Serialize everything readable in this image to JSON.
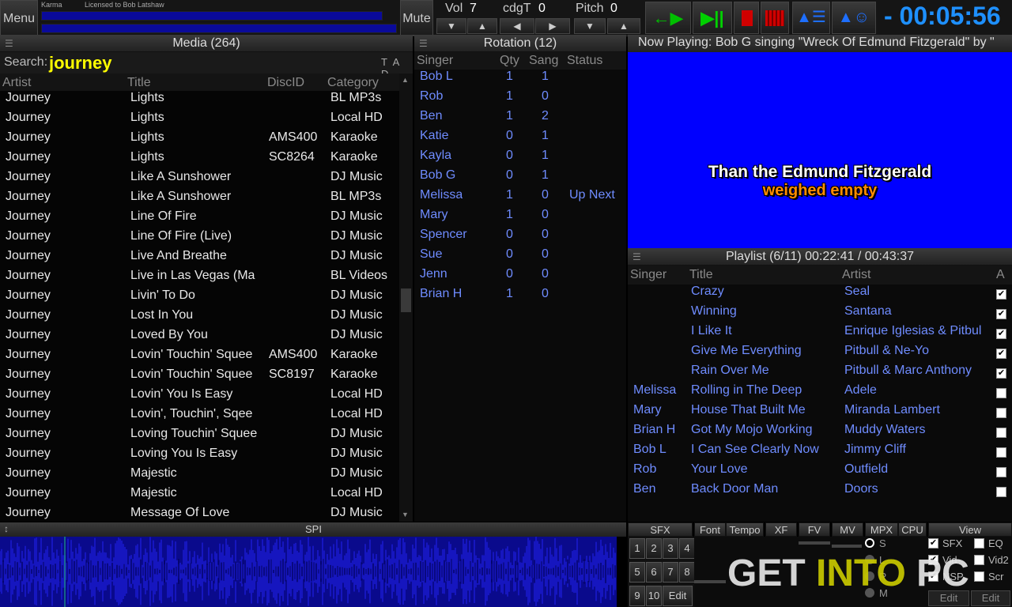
{
  "topbar": {
    "menu_label": "Menu",
    "karma_label": "Karma",
    "license_text": "Licensed to Bob Latshaw",
    "mute_label": "Mute",
    "vol_label": "Vol",
    "vol_value": "7",
    "cdgt_label": "cdgT",
    "cdgt_value": "0",
    "pitch_label": "Pitch",
    "pitch_value": "0",
    "timer": "- 00:05:56",
    "icons": {
      "arrow_down": "▼",
      "arrow_up": "▲",
      "arrow_left": "◀",
      "arrow_right": "▶",
      "prev": "←▶",
      "play_pause": "▶||",
      "stop": "stop-icon",
      "queue": "▲☰",
      "singer": "▲☺"
    },
    "colors": {
      "blue_text": "#1e90ff",
      "green": "#00c000",
      "red": "#d00000"
    }
  },
  "media": {
    "title": "Media (264)",
    "search_label": "Search:",
    "search_value": "journey",
    "tad": "T A D",
    "columns": [
      "Artist",
      "Title",
      "DiscID",
      "Category"
    ],
    "rows": [
      [
        "Journey",
        "Lights",
        "",
        "BL MP3s"
      ],
      [
        "Journey",
        "Lights",
        "",
        "Local HD"
      ],
      [
        "Journey",
        "Lights",
        "AMS400",
        "Karaoke"
      ],
      [
        "Journey",
        "Lights",
        "SC8264",
        "Karaoke"
      ],
      [
        "Journey",
        "Like A Sunshower",
        "",
        "DJ Music"
      ],
      [
        "Journey",
        "Like A Sunshower",
        "",
        "BL MP3s"
      ],
      [
        "Journey",
        "Line Of Fire",
        "",
        "DJ Music"
      ],
      [
        "Journey",
        "Line Of Fire (Live)",
        "",
        "DJ Music"
      ],
      [
        "Journey",
        "Live And Breathe",
        "",
        "DJ Music"
      ],
      [
        "Journey",
        "Live in Las Vegas (Ma",
        "",
        "BL Videos"
      ],
      [
        "Journey",
        "Livin' To Do",
        "",
        "DJ Music"
      ],
      [
        "Journey",
        "Lost In You",
        "",
        "DJ Music"
      ],
      [
        "Journey",
        "Loved By You",
        "",
        "DJ Music"
      ],
      [
        "Journey",
        "Lovin' Touchin' Squee",
        "AMS400",
        "Karaoke"
      ],
      [
        "Journey",
        "Lovin' Touchin' Squee",
        "SC8197",
        "Karaoke"
      ],
      [
        "Journey",
        "Lovin' You Is Easy",
        "",
        "Local HD"
      ],
      [
        "Journey",
        "Lovin', Touchin', Sqee",
        "",
        "Local HD"
      ],
      [
        "Journey",
        "Loving Touchin' Squee",
        "",
        "DJ Music"
      ],
      [
        "Journey",
        "Loving You Is Easy",
        "",
        "DJ Music"
      ],
      [
        "Journey",
        "Majestic",
        "",
        "DJ Music"
      ],
      [
        "Journey",
        "Majestic",
        "",
        "Local HD"
      ],
      [
        "Journey",
        "Message Of Love",
        "",
        "DJ Music"
      ]
    ]
  },
  "rotation": {
    "title": "Rotation (12)",
    "columns": [
      "Singer",
      "Qty",
      "Sang",
      "Status"
    ],
    "rows": [
      [
        "Bob L",
        "1",
        "1",
        ""
      ],
      [
        "Rob",
        "1",
        "0",
        ""
      ],
      [
        "Ben",
        "1",
        "2",
        ""
      ],
      [
        "Katie",
        "0",
        "1",
        ""
      ],
      [
        "Kayla",
        "0",
        "1",
        ""
      ],
      [
        "Bob G",
        "0",
        "1",
        ""
      ],
      [
        "Melissa",
        "1",
        "0",
        "Up Next"
      ],
      [
        "Mary",
        "1",
        "0",
        ""
      ],
      [
        "Spencer",
        "0",
        "0",
        ""
      ],
      [
        "Sue",
        "0",
        "0",
        ""
      ],
      [
        "Jenn",
        "0",
        "0",
        ""
      ],
      [
        "Brian H",
        "1",
        "0",
        ""
      ]
    ]
  },
  "now_playing": {
    "title": "Now Playing:  Bob G singing \"Wreck Of Edmund Fitzgerald\" by \"",
    "lyric_line1": "Than the Edmund Fitzgerald",
    "lyric_line2": "weighed empty"
  },
  "playlist": {
    "title": "Playlist (6/11)  00:22:41 / 00:43:37",
    "columns": [
      "Singer",
      "Title",
      "Artist",
      "A"
    ],
    "rows": [
      {
        "singer": "",
        "title": "Crazy",
        "artist": "Seal",
        "checked": true
      },
      {
        "singer": "",
        "title": "Winning",
        "artist": "Santana",
        "checked": true
      },
      {
        "singer": "",
        "title": "I Like It",
        "artist": "Enrique Iglesias & Pitbul",
        "checked": true
      },
      {
        "singer": "",
        "title": "Give Me Everything",
        "artist": "Pitbull & Ne-Yo",
        "checked": true
      },
      {
        "singer": "",
        "title": "Rain Over Me",
        "artist": "Pitbull & Marc Anthony",
        "checked": true
      },
      {
        "singer": "Melissa",
        "title": "Rolling in The Deep",
        "artist": "Adele",
        "checked": false
      },
      {
        "singer": "Mary",
        "title": "House That Built Me",
        "artist": "Miranda Lambert",
        "checked": false
      },
      {
        "singer": "Brian H",
        "title": "Got My Mojo Working",
        "artist": "Muddy Waters",
        "checked": false
      },
      {
        "singer": "Bob L",
        "title": "I Can See Clearly Now",
        "artist": "Jimmy Cliff",
        "checked": false
      },
      {
        "singer": "Rob",
        "title": "Your Love",
        "artist": "Outfield",
        "checked": false
      },
      {
        "singer": "Ben",
        "title": "Back Door Man",
        "artist": "Doors",
        "checked": false
      }
    ],
    "check_mark": "✔"
  },
  "spi": {
    "label": "SPI"
  },
  "sfx": {
    "label": "SFX",
    "buttons": [
      "1",
      "2",
      "3",
      "4",
      "5",
      "6",
      "7",
      "8",
      "9",
      "10",
      "Edit"
    ]
  },
  "tabs": [
    "Font",
    "Tempo",
    "XF",
    "FV",
    "MV",
    "MPX",
    "CPU"
  ],
  "view": {
    "label": "View",
    "radios": [
      "S",
      "L",
      "R",
      "M"
    ],
    "checks": [
      {
        "label": "SFX",
        "checked": true
      },
      {
        "label": "EQ",
        "checked": false
      },
      {
        "label": "Vid",
        "checked": true
      },
      {
        "label": "Vid2",
        "checked": false
      },
      {
        "label": "NSP",
        "checked": true
      },
      {
        "label": "Scr",
        "checked": false
      }
    ],
    "edit1": "Edit",
    "edit2": "Edit"
  },
  "watermark": {
    "part1": "GET ",
    "part2": "INTO",
    "part3": " PC"
  }
}
